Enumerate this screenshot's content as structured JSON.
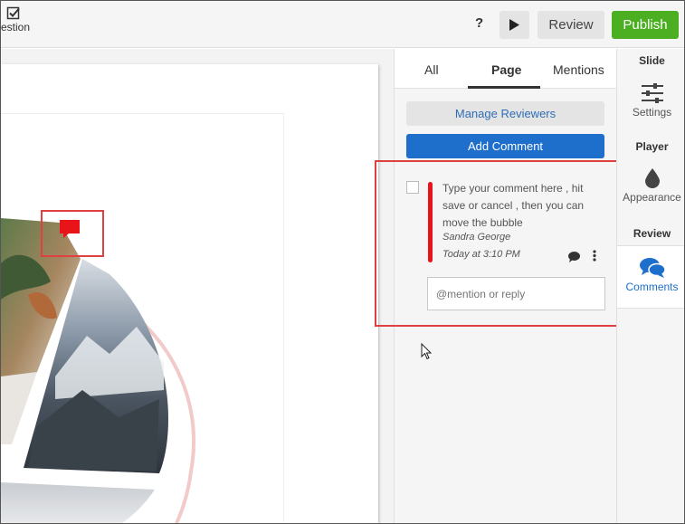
{
  "toolbar": {
    "question_label": "estion",
    "help_label": "?",
    "review_label": "Review",
    "publish_label": "Publish"
  },
  "panel": {
    "tabs": [
      {
        "label": "All"
      },
      {
        "label": "Page",
        "active": true
      },
      {
        "label": "Mentions"
      }
    ],
    "manage_reviewers_label": "Manage Reviewers",
    "add_comment_label": "Add Comment",
    "comment": {
      "text": "Type your comment here , hit save or cancel ,  then you can move the bubble",
      "author": "Sandra George",
      "time": "Today at 3:10 PM"
    },
    "reply_placeholder": "@mention or reply"
  },
  "sidebar": {
    "slide_heading": "Slide",
    "settings_label": "Settings",
    "player_heading": "Player",
    "appearance_label": "Appearance",
    "review_heading": "Review",
    "comments_label": "Comments"
  },
  "colors": {
    "publish": "#4caf22",
    "primary": "#1e6ecb",
    "highlight": "#e04040",
    "comment_bar": "#e8141a"
  }
}
